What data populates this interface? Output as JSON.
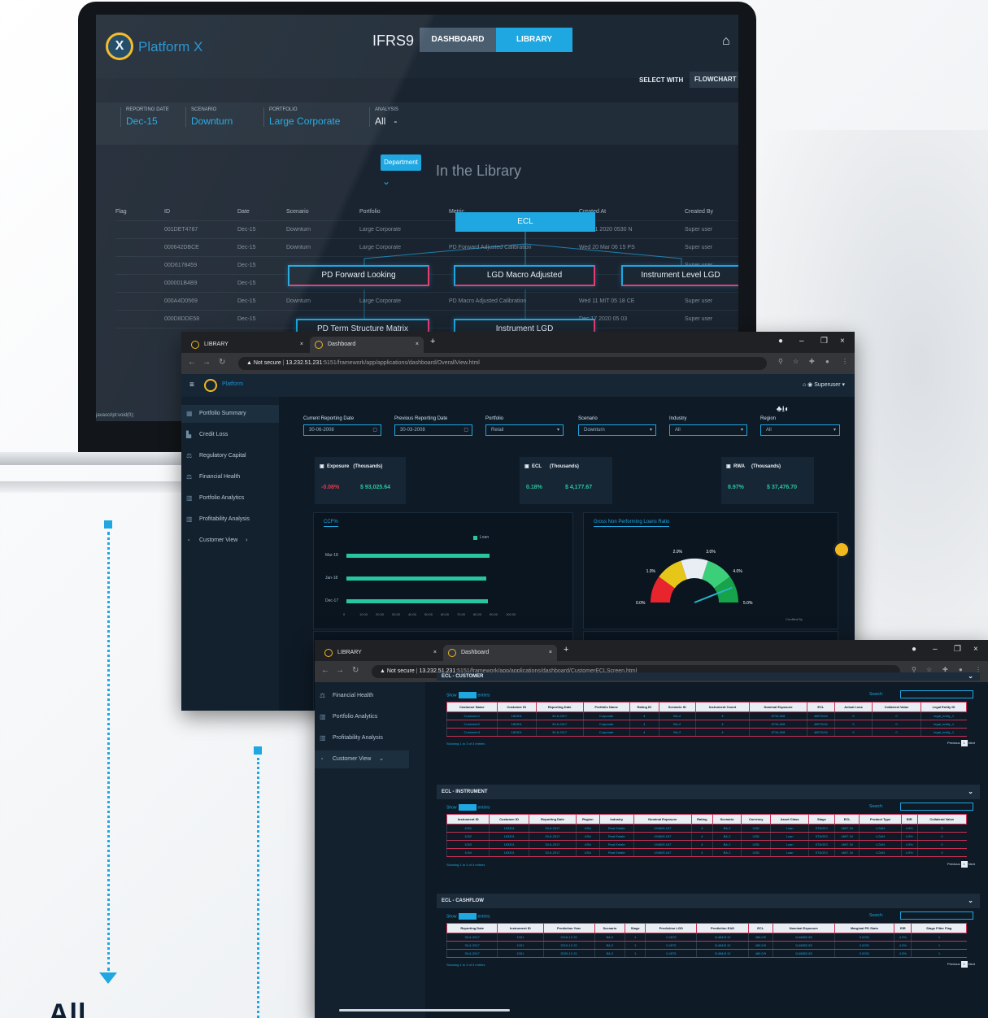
{
  "laptop": {
    "brand": "Platform X",
    "logo_letter": "X",
    "module_title": "IFRS9",
    "tabs": [
      "DASHBOARD",
      "LIBRARY"
    ],
    "home_icon": "home-icon",
    "select_with_label": "SELECT WITH",
    "select_with_value": "FLOWCHART",
    "filters": [
      {
        "label": "REPORTING DATE",
        "value": "Dec-15"
      },
      {
        "label": "SCENARIO",
        "value": "Downturn"
      },
      {
        "label": "PORTFOLIO",
        "value": "Large Corporate"
      },
      {
        "label": "ANALYSIS",
        "value": "All"
      }
    ],
    "dept_button": "Department",
    "in_library": "In the Library",
    "table_headers": [
      "Flag",
      "ID",
      "Date",
      "Scenario",
      "Portfolio",
      "Metric",
      "Created At",
      "Created By"
    ],
    "table_rows": [
      [
        "",
        "001DET4787",
        "Dec-15",
        "Downturn",
        "Large Corporate",
        "",
        "Wed 11 2020 0530 N",
        "Super user"
      ],
      [
        "",
        "000642DBCE",
        "Dec-15",
        "Downturn",
        "Large Corporate",
        "PD Forward Adjusted Calibration",
        "Wed 20 Mar 06 15 PS",
        "Super user"
      ],
      [
        "",
        "00D6178459",
        "Dec-15",
        "",
        "",
        "",
        "",
        "Super user"
      ],
      [
        "",
        "000001B4B9",
        "Dec-15",
        "",
        "",
        "",
        "",
        "Super user"
      ],
      [
        "",
        "000A4D0569",
        "Dec-15",
        "Downturn",
        "Large Corporate",
        "PD Macro Adjusted Calibration",
        "Wed 11 MIT 05 18 CE",
        "Super user"
      ],
      [
        "",
        "000D8DDE58",
        "Dec-15",
        "",
        "",
        "",
        "Dec 17 2020 05 03",
        "Super user"
      ]
    ],
    "tree": {
      "root": "ECL",
      "nodes": [
        "PD Forward Looking",
        "LGD Macro Adjusted",
        "Instrument Level LGD",
        "PD Term Structure Matrix",
        "Instrument LGD"
      ]
    },
    "status_text": "javascript:void(0);"
  },
  "browser1": {
    "tabs": [
      {
        "label": "LIBRARY"
      },
      {
        "label": "Dashboard"
      }
    ],
    "url_warning": "Not secure",
    "url_host": "13.232.51.231",
    "url_path": ":5151/framework/app/applications/dashboard/OverallView.html",
    "app_name": "Platform",
    "user": "Superuser",
    "sidebar": [
      {
        "label": "Portfolio Summary",
        "icon": "grid-icon"
      },
      {
        "label": "Credit Loss",
        "icon": "bars-icon"
      },
      {
        "label": "Regulatory Capital",
        "icon": "scale-icon"
      },
      {
        "label": "Financial Health",
        "icon": "scale-icon"
      },
      {
        "label": "Portfolio Analytics",
        "icon": "chart-icon"
      },
      {
        "label": "Profitability Analysis",
        "icon": "chart-icon"
      },
      {
        "label": "Customer View",
        "icon": "user-icon"
      }
    ],
    "filters": [
      {
        "label": "Current Reporting Date",
        "value": "30-06-2008"
      },
      {
        "label": "Previous Reporting Date",
        "value": "30-03-2008"
      },
      {
        "label": "Portfolio",
        "value": "Retail"
      },
      {
        "label": "Scenario",
        "value": "Downturn"
      },
      {
        "label": "Industry",
        "value": "All"
      },
      {
        "label": "Region",
        "value": "All"
      }
    ],
    "kpis": [
      {
        "name": "Exposure",
        "unit": "(Thousands)",
        "pct": "-0.08%",
        "amount": "$ 93,025.64",
        "pct_color": "#e8394f"
      },
      {
        "name": "ECL",
        "unit": "(Thousands)",
        "pct": "0.18%",
        "amount": "$ 4,177.67",
        "pct_color": "#27c6a0"
      },
      {
        "name": "RWA",
        "unit": "(Thousands)",
        "pct": "8.97%",
        "amount": "$ 37,476.70",
        "pct_color": "#27c6a0"
      }
    ],
    "ccf_panel_title": "CCF%",
    "gauge_panel_title": "Gross Non Performing Loans Ratio",
    "gauge_status": "Credited By",
    "gauge_labels": [
      "0.0%",
      "1.0%",
      "2.0%",
      "3.0%",
      "4.0%",
      "5.0%"
    ],
    "gauge_value": 4.4,
    "colors": {
      "accent": "#1ea7e1",
      "positive": "#27c6a0",
      "negative": "#e8394f",
      "gold": "#f2b820"
    }
  },
  "chart_data": {
    "type": "bar",
    "title": "CCF%",
    "orientation": "horizontal",
    "categories": [
      "Mar-18",
      "Jan-18",
      "Dec-17"
    ],
    "series": [
      {
        "name": "Loan",
        "values": [
          88,
          86,
          87
        ]
      }
    ],
    "xlim": [
      0,
      100
    ],
    "x_ticks": [
      "0",
      "10.00",
      "20.00",
      "30.00",
      "40.00",
      "50.00",
      "60.00",
      "70.00",
      "80.00",
      "90.00",
      "100.00"
    ],
    "legend": "top-right"
  },
  "browser2": {
    "tabs": [
      {
        "label": "LIBRARY"
      },
      {
        "label": "Dashboard"
      }
    ],
    "url_warning": "Not secure",
    "url_host": "13.232.51.231",
    "url_path": ":5151/framework/app/applications/dashboard/CustomerECLScreen.html",
    "sidebar": [
      {
        "label": "Financial Health"
      },
      {
        "label": "Portfolio Analytics"
      },
      {
        "label": "Profitability Analysis"
      },
      {
        "label": "Customer View"
      }
    ],
    "show_label": "Show",
    "entries_label": "entries",
    "search_label": "Search:",
    "previous_label": "Previous",
    "next_label": "Next",
    "sections": [
      {
        "title": "ECL - CUSTOMER",
        "headers": [
          "Customer Name",
          "Customer ID",
          "Reporting Date",
          "Portfolio Name",
          "Rating ID",
          "Scenario ID",
          "Instrument Count",
          "Nominal Exposure",
          "ECL",
          "Actual Loss",
          "Collateral Value",
          "Legal Entity ID"
        ],
        "rows": [
          [
            "Customer1",
            "183301",
            "30-6-2017",
            "Corporate",
            "4",
            "BA-2",
            "4",
            "8734,908",
            "48970/34",
            "0",
            "0",
            "legal_entity_1"
          ],
          [
            "Customer2",
            "183301",
            "30-6-2017",
            "Corporate",
            "4",
            "BA-2",
            "4",
            "8734,908",
            "48970/34",
            "0",
            "0",
            "legal_entity_1"
          ],
          [
            "Customer3",
            "183301",
            "30-6-2017",
            "Corporate",
            "4",
            "BA-2",
            "4",
            "8734,908",
            "48970/34",
            "0",
            "0",
            "legal_entity_1"
          ]
        ],
        "showing": "Showing 1 to 3 of 3 entries"
      },
      {
        "title": "ECL - INSTRUMENT",
        "headers": [
          "Instrument ID",
          "Customer ID",
          "Reporting Date",
          "Region",
          "Industry",
          "Nominal Exposure",
          "Rating",
          "Scenario",
          "Currency",
          "Asset Class",
          "Stage",
          "ECL",
          "Product Type",
          "EIR",
          "Collateral Value"
        ],
        "rows": [
          [
            "1001",
            "183301",
            "30-6-2017",
            "USA",
            "Real Estate",
            "194605.167",
            "4",
            "BA-2",
            "USD",
            "Loan",
            "STAGE1",
            "4657.34",
            "LOAN",
            "4.5%",
            "0"
          ],
          [
            "1002",
            "183301",
            "30-6-2017",
            "USA",
            "Real Estate",
            "194605.167",
            "4",
            "BA-2",
            "USD",
            "Loan",
            "STAGE1",
            "4657.34",
            "LOAN",
            "4.5%",
            "0"
          ],
          [
            "1003",
            "183301",
            "30-6-2017",
            "USA",
            "Real Estate",
            "194605.167",
            "4",
            "BA-2",
            "USD",
            "Loan",
            "STAGE1",
            "4657.34",
            "LOAN",
            "4.5%",
            "0"
          ],
          [
            "1004",
            "183301",
            "30-6-2017",
            "USA",
            "Real Estate",
            "194605.167",
            "4",
            "BA-2",
            "USD",
            "Loan",
            "STAGE1",
            "4657.34",
            "LOAN",
            "4.5%",
            "0"
          ]
        ],
        "showing": "Showing 1 to 4 of 4 entries"
      },
      {
        "title": "ECL - CASHFLOW",
        "headers": [
          "Reporting Date",
          "Instrument ID",
          "Prediction Year",
          "Scenario",
          "Stage",
          "Prediction LGD",
          "Prediction EAD",
          "ECL",
          "Nominal Exposure",
          "Marginal PD Stats",
          "EIR",
          "Stage Filter Flag"
        ],
        "rows": [
          [
            "30-6-2017",
            "1001",
            "2018-12-31",
            "BA-2",
            "1",
            "0.4575",
            "11484/8.12",
            "460.0/9",
            "1148852.85",
            "0.0031",
            "4.5%",
            "1"
          ],
          [
            "30-6-2017",
            "1001",
            "2019-12-31",
            "BA-2",
            "1",
            "0.4575",
            "11484/8.12",
            "460.0/9",
            "1148852.85",
            "0.0031",
            "4.5%",
            "1"
          ],
          [
            "30-6-2017",
            "1001",
            "2020-12-31",
            "BA-2",
            "1",
            "0.4575",
            "11484/8.12",
            "460.0/9",
            "1148852.85",
            "0.0031",
            "4.5%",
            "1"
          ]
        ],
        "showing": "Showing 1 to 3 of 3 entries"
      }
    ]
  },
  "bottom_text": "All"
}
